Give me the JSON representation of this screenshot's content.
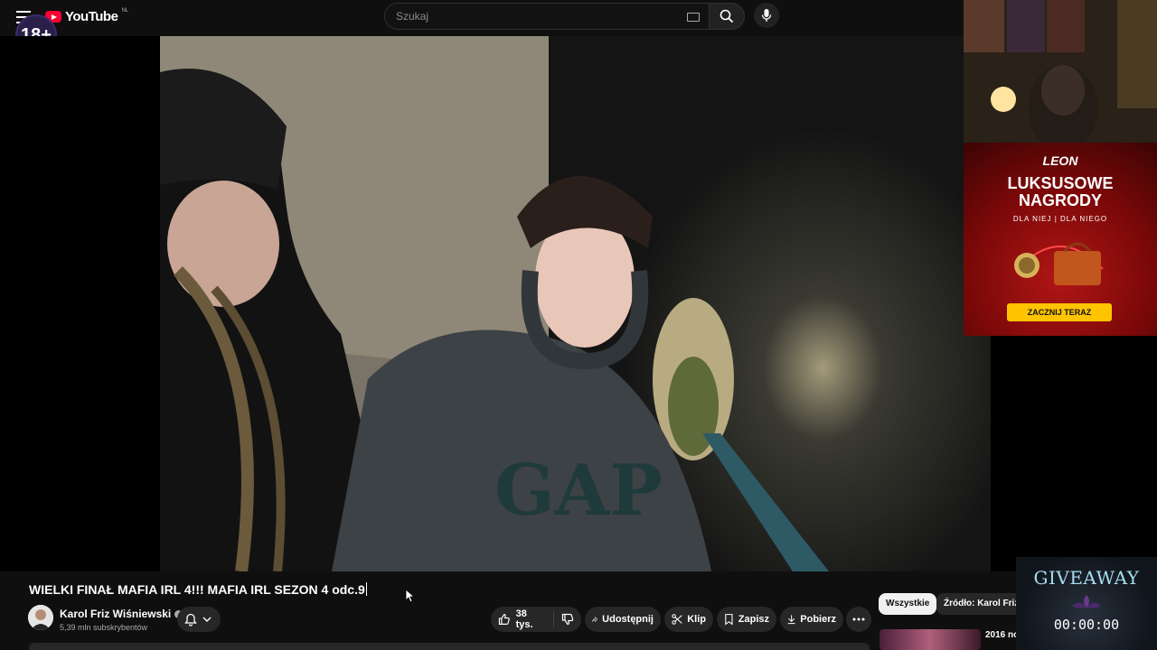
{
  "header": {
    "logo_text": "YouTube",
    "region": "NL",
    "age_badge": "18+",
    "search_placeholder": "Szukaj"
  },
  "ad": {
    "brand": "LEON",
    "headline_line1": "LUKSUSOWE",
    "headline_line2": "NAGRODY",
    "subline": "DLA NIEJ | DLA NIEGO",
    "cta": "ZACZNIJ TERAZ",
    "accent": "#ffc400"
  },
  "video": {
    "title": "WIELKI FINAŁ MAFIA IRL 4!!! MAFIA IRL SEZON 4 odc.9",
    "hoodie_text": "GAP"
  },
  "channel": {
    "name": "Karol Friz Wiśniewski",
    "subscribers": "5,39 mln subskrybentów"
  },
  "actions": {
    "likes": "38 tys.",
    "share": "Udostępnij",
    "clip": "Klip",
    "save": "Zapisz",
    "download": "Pobierz"
  },
  "chips": [
    "Wszystkie",
    "Źródło: Karol Friz W"
  ],
  "recommended": {
    "title": "2016 no"
  },
  "overlay": {
    "giveaway": "GIVEAWAY",
    "timer": "00:00:00"
  }
}
